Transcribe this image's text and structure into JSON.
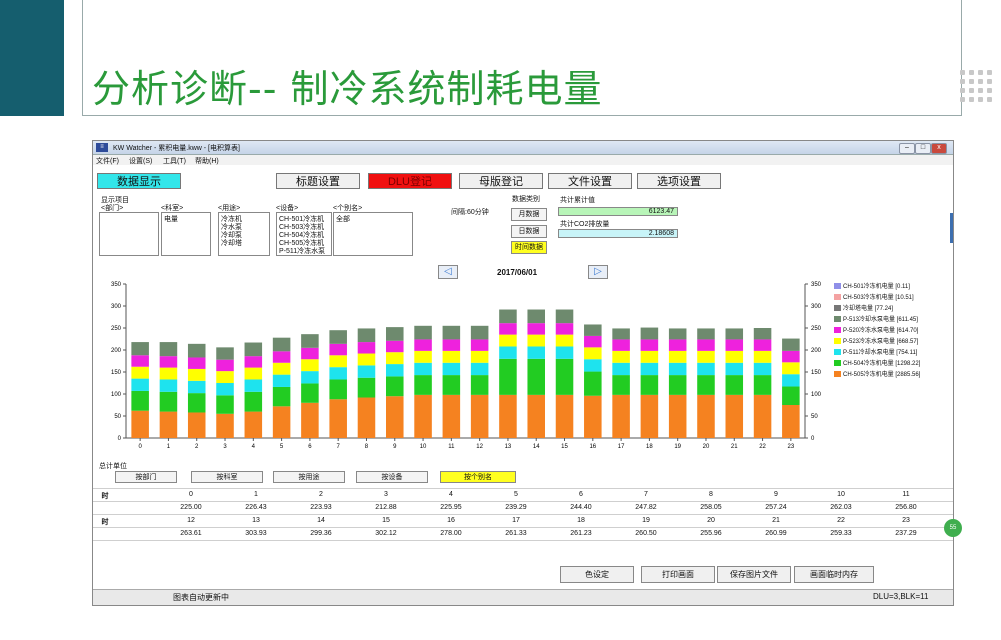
{
  "slide": {
    "title": "分析诊断-- 制冷系统制耗电量"
  },
  "window": {
    "title": "KW Watcher - 累积电量.kww - [电积算表]",
    "menu": [
      "文件(F)",
      "设置(S)",
      "工具(T)",
      "帮助(H)"
    ],
    "toolbar": [
      "数据显示",
      "标题设置",
      "DLU登记",
      "母版登记",
      "文件设置",
      "选项设置"
    ],
    "toolbar_colors": {
      "active": "#33e6ea",
      "red": "#f01010"
    }
  },
  "filters": {
    "section_label": "显示项目",
    "dept_label": "<部门>",
    "account_label": "<科室>",
    "account_value": "电量",
    "usage_label": "<用途>",
    "usage_items": [
      "冷冻机",
      "冷水泵",
      "冷却泵",
      "冷却塔"
    ],
    "device_label": "<设备>",
    "device_items": [
      "CH-501冷冻机",
      "CH-503冷冻机",
      "CH-504冷冻机",
      "CH-505冷冻机",
      "P-511冷冻水泵"
    ],
    "alias_label": "<个别名>",
    "alias_value": "全部",
    "interval": "间隔:60分钟",
    "data_type_label": "数据类别",
    "data_type_buttons": [
      "月数据",
      "日数据",
      "时间数据"
    ],
    "total_label": "共计累计值",
    "total_value": "6123.47",
    "co2_label": "共计CO2排放量",
    "co2_value": "2.18608"
  },
  "chart_nav": {
    "date": "2017/06/01",
    "prev": "◁",
    "next": "▷"
  },
  "chart_data": {
    "type": "bar",
    "stacked": true,
    "categories": [
      "0",
      "1",
      "2",
      "3",
      "4",
      "5",
      "6",
      "7",
      "8",
      "9",
      "10",
      "11",
      "12",
      "13",
      "14",
      "15",
      "16",
      "17",
      "18",
      "19",
      "20",
      "21",
      "22",
      "23"
    ],
    "ylim": [
      0,
      350
    ],
    "yticks_left": [
      0,
      50,
      100,
      150,
      200,
      250,
      300,
      350
    ],
    "yticks_right": [
      0,
      50,
      100,
      150,
      200,
      250,
      300,
      350
    ],
    "series": [
      {
        "name": "CH-505冷冻机电量 [2885.56]",
        "color": "#f58220",
        "values": [
          62,
          60,
          58,
          55,
          60,
          72,
          80,
          88,
          92,
          95,
          98,
          98,
          98,
          98,
          98,
          98,
          96,
          98,
          98,
          98,
          98,
          98,
          98,
          75
        ]
      },
      {
        "name": "CH-504冷冻机电量 [1298.22]",
        "color": "#22cc22",
        "values": [
          45,
          45,
          44,
          42,
          45,
          44,
          44,
          45,
          45,
          45,
          45,
          45,
          45,
          82,
          82,
          82,
          55,
          45,
          45,
          45,
          45,
          45,
          45,
          42
        ]
      },
      {
        "name": "P-511冷却水泵电量 [754.11]",
        "color": "#1ee3ee",
        "values": [
          28,
          28,
          28,
          28,
          28,
          28,
          28,
          28,
          28,
          28,
          28,
          28,
          28,
          28,
          28,
          28,
          28,
          28,
          28,
          28,
          28,
          28,
          28,
          28
        ]
      },
      {
        "name": "P-523冷冻水泵电量 [668.57]",
        "color": "#ffff00",
        "values": [
          27,
          27,
          27,
          27,
          27,
          27,
          27,
          27,
          27,
          27,
          27,
          27,
          27,
          27,
          27,
          27,
          27,
          27,
          27,
          27,
          27,
          27,
          27,
          27
        ]
      },
      {
        "name": "P-520冷冻水泵电量 [614.70]",
        "color": "#ee22dd",
        "values": [
          26,
          26,
          26,
          26,
          26,
          26,
          26,
          26,
          26,
          26,
          26,
          26,
          26,
          26,
          26,
          26,
          26,
          26,
          26,
          26,
          26,
          26,
          26,
          26
        ]
      },
      {
        "name": "P-513冷却水泵电量 [611.45]",
        "color": "#6e8a6e",
        "values": [
          30,
          32,
          31,
          28,
          31,
          31,
          31,
          31,
          31,
          31,
          31,
          31,
          31,
          31,
          31,
          31,
          26,
          25,
          27,
          25,
          25,
          25,
          26,
          28
        ]
      },
      {
        "name": "冷却塔电量 [77.24]",
        "color": "#777777",
        "values": [
          0,
          0,
          0,
          0,
          0,
          0,
          0,
          0,
          0,
          0,
          0,
          0,
          0,
          0,
          0,
          0,
          0,
          0,
          0,
          0,
          0,
          0,
          0,
          0
        ]
      },
      {
        "name": "CH-503冷冻机电量 [10.51]",
        "color": "#f4a2a2",
        "values": [
          0,
          0,
          0,
          0,
          0,
          0,
          0,
          0,
          0,
          0,
          0,
          0,
          0,
          0,
          0,
          0,
          0,
          0,
          0,
          0,
          0,
          0,
          0,
          0
        ]
      },
      {
        "name": "CH-501冷冻机电量 [0.11]",
        "color": "#8f8fe8",
        "values": [
          0,
          0,
          0,
          0,
          0,
          0,
          0,
          0,
          0,
          0,
          0,
          0,
          0,
          0,
          0,
          0,
          0,
          0,
          0,
          0,
          0,
          0,
          0,
          0
        ]
      }
    ],
    "legend_placement": "right",
    "grid": false
  },
  "summary": {
    "label": "总计单位",
    "unit_buttons": [
      "按部门",
      "按科室",
      "按用途",
      "按设备",
      "按个别名"
    ],
    "row_label": "时",
    "hours_row1": [
      "0",
      "1",
      "2",
      "3",
      "4",
      "5",
      "6",
      "7",
      "8",
      "9",
      "10",
      "11"
    ],
    "values_row1": [
      "225.00",
      "226.43",
      "223.93",
      "212.88",
      "225.95",
      "239.29",
      "244.40",
      "247.82",
      "258.05",
      "257.24",
      "262.03",
      "256.80"
    ],
    "hours_row2": [
      "12",
      "13",
      "14",
      "15",
      "16",
      "17",
      "18",
      "19",
      "20",
      "21",
      "22",
      "23"
    ],
    "values_row2": [
      "263.61",
      "303.93",
      "299.36",
      "302.12",
      "278.00",
      "261.33",
      "261.23",
      "260.50",
      "255.96",
      "260.99",
      "259.33",
      "237.29"
    ]
  },
  "bottom_buttons": [
    "色设定",
    "打印画面",
    "保存图片文件",
    "画面临时内存"
  ],
  "status": {
    "left": "图表自动更新中",
    "right": "DLU=3,BLK=11"
  }
}
